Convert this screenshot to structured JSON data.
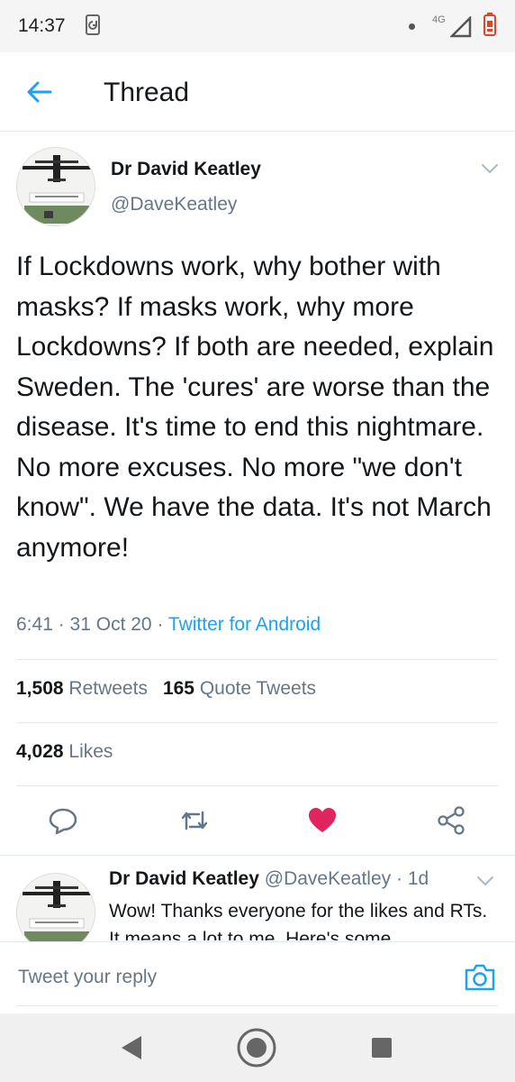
{
  "status_bar": {
    "time": "14:37",
    "network": "4G"
  },
  "header": {
    "title": "Thread"
  },
  "tweet": {
    "author_name": "Dr David Keatley",
    "author_handle": "@DaveKeatley",
    "text": "If Lockdowns work, why bother with masks? If masks work, why more Lockdowns? If both are needed, explain Sweden. The 'cures' are worse than the disease. It's time to end this nightmare. No more excuses. No more \"we don't know\". We have the data. It's not March anymore!",
    "time": "6:41",
    "date": "31 Oct 20",
    "source": "Twitter for Android",
    "retweets_count": "1,508",
    "retweets_label": "Retweets",
    "quotes_count": "165",
    "quotes_label": "Quote Tweets",
    "likes_count": "4,028",
    "likes_label": "Likes",
    "liked": true
  },
  "reply": {
    "author_name": "Dr David Keatley",
    "author_handle": "@DaveKeatley",
    "age": "1d",
    "text": "Wow! Thanks everyone for the likes and RTs. It means a lot to me. Here's some"
  },
  "compose": {
    "placeholder": "Tweet your reply"
  },
  "colors": {
    "accent": "#1da1f2",
    "like": "#e0245e",
    "secondary_text": "#657786",
    "primary_text": "#14171a"
  }
}
